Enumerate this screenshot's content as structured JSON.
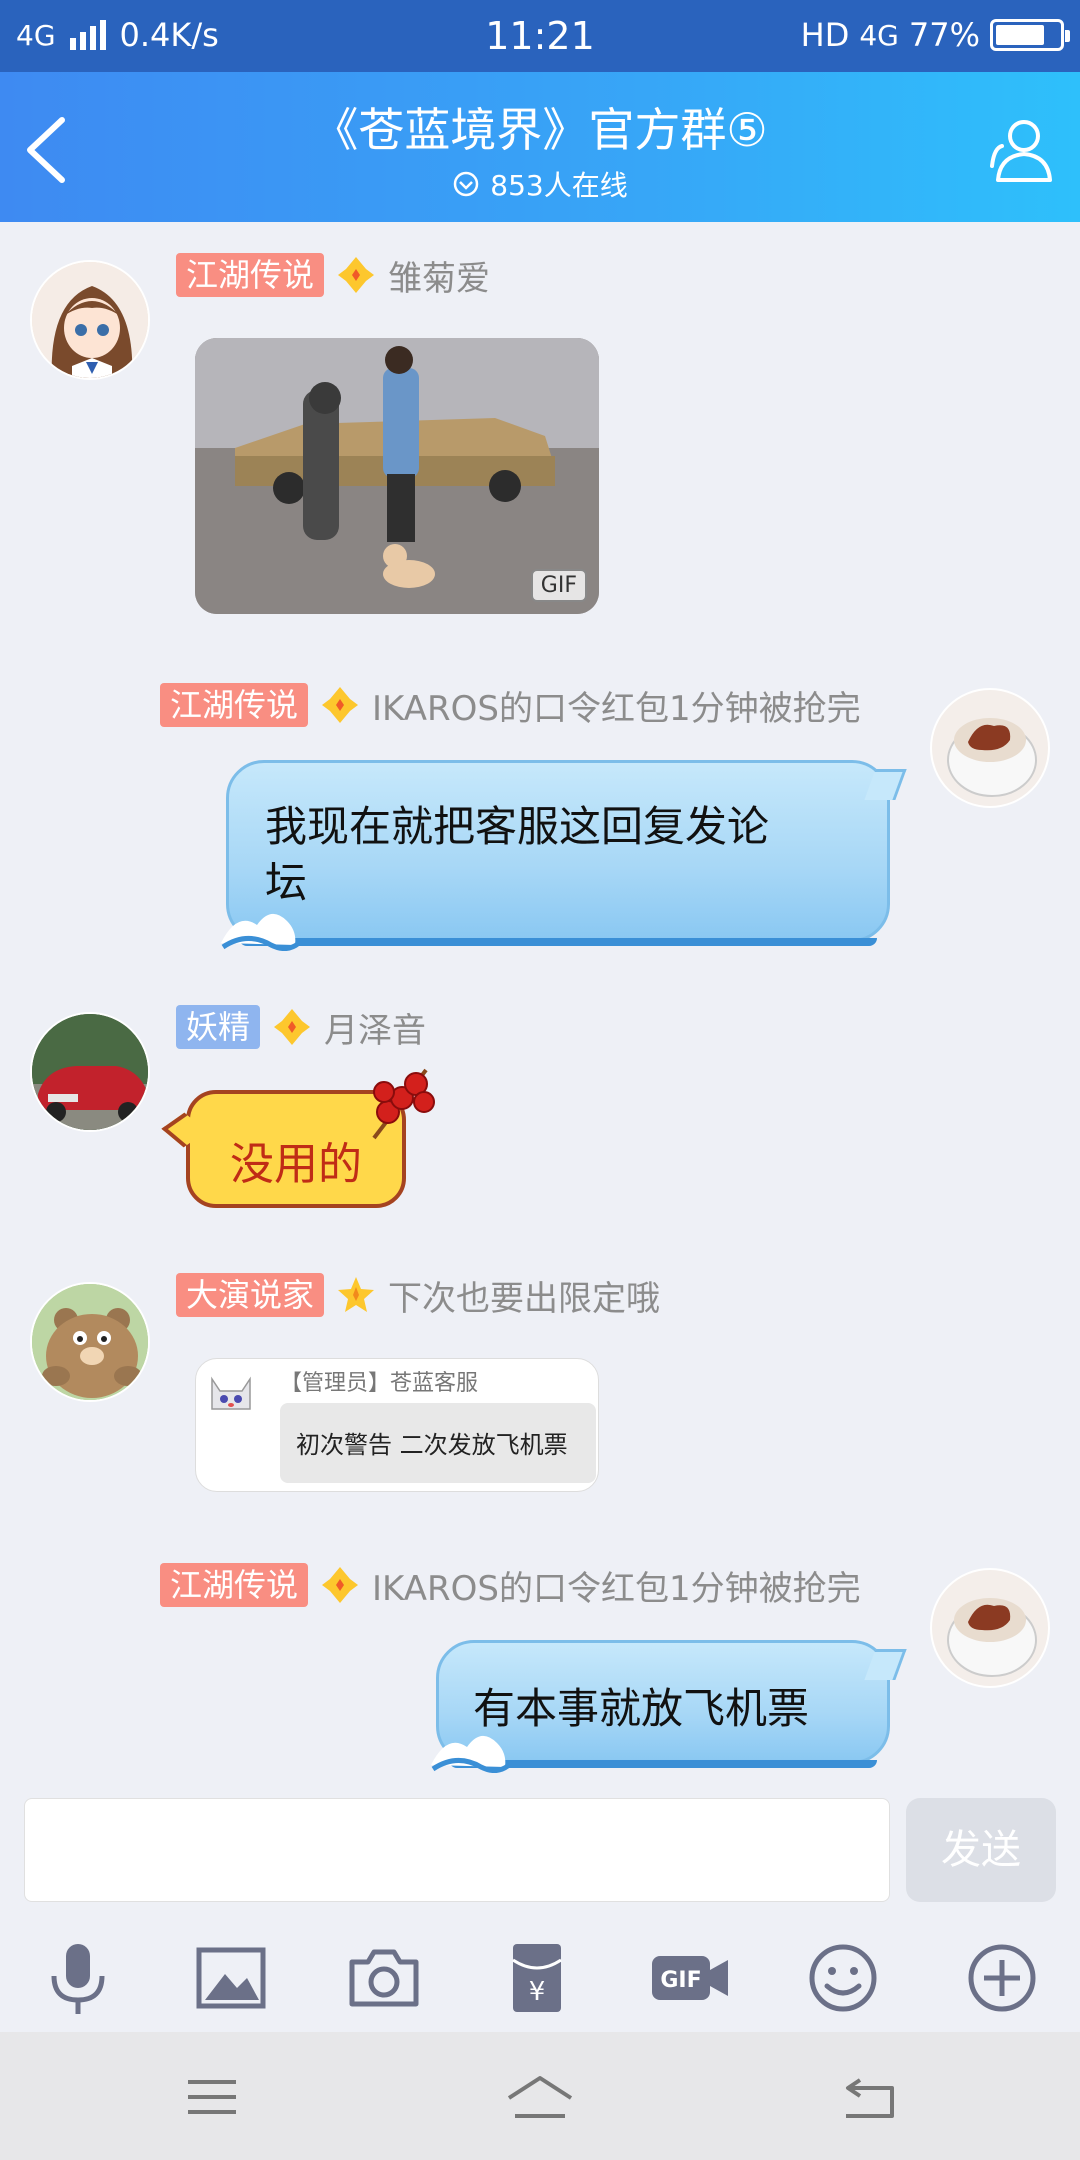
{
  "status_bar": {
    "network": "4G",
    "speed": "0.4K/s",
    "time": "11:21",
    "hd": "HD",
    "network_right": "4G",
    "battery": "77%",
    "battery_level": 0.77
  },
  "header": {
    "title": "《苍蓝境界》官方群⑤",
    "online": "853人在线"
  },
  "messages": [
    {
      "side": "left",
      "tag": "江湖传说",
      "nick": "雏菊爱",
      "type": "gif",
      "gif_badge": "GIF"
    },
    {
      "side": "right",
      "tag": "江湖传说",
      "nick": "IKAROS的口令红包1分钟被抢完",
      "type": "text",
      "lines": [
        "我现在就把客服这回复发论",
        "坛"
      ]
    },
    {
      "side": "left",
      "tag": "妖精",
      "nick": "月泽音",
      "type": "text",
      "text": "没用的"
    },
    {
      "side": "left",
      "tag": "大演说家",
      "nick": "下次也要出限定哦",
      "type": "screenshot",
      "shot_name": "【管理员】苍蓝客服",
      "shot_text": "初次警告 二次发放飞机票"
    },
    {
      "side": "right",
      "tag": "江湖传说",
      "nick": "IKAROS的口令红包1分钟被抢完",
      "type": "text",
      "text": "有本事就放飞机票"
    }
  ],
  "input": {
    "value": "",
    "send_label": "发送"
  },
  "toolbar_icons": [
    "microphone-icon",
    "image-icon",
    "camera-icon",
    "red-packet-icon",
    "gif-icon",
    "emoji-icon",
    "plus-icon"
  ],
  "colors": {
    "header": "#3e8af2",
    "tag_red": "#f98e82",
    "tag_blue": "#8fb5ef",
    "bubble_blue": "#a7d7f6",
    "bubble_yellow": "#ffd84a"
  }
}
